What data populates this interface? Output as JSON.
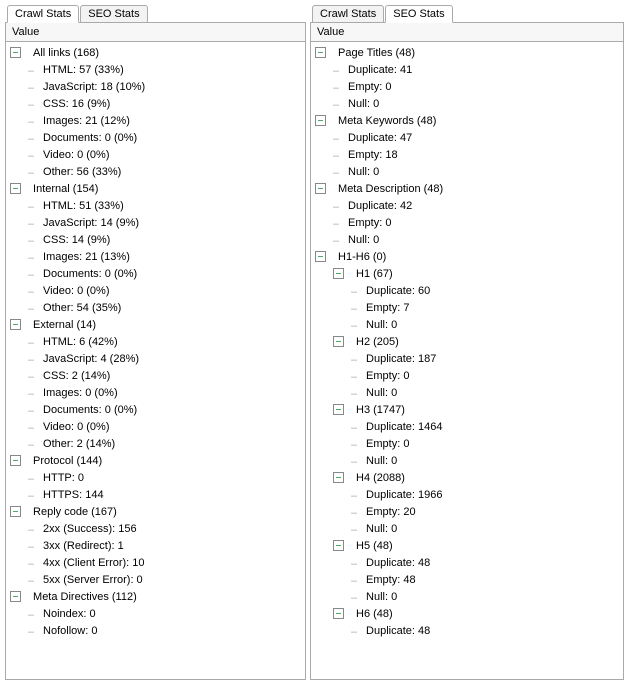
{
  "left": {
    "tabs": [
      "Crawl Stats",
      "SEO Stats"
    ],
    "active_tab_index": 0,
    "header": "Value",
    "tree": [
      {
        "depth": 0,
        "toggle": "minus",
        "label": "All links (168)"
      },
      {
        "depth": 1,
        "label": "HTML: 57 (33%)"
      },
      {
        "depth": 1,
        "label": "JavaScript: 18 (10%)"
      },
      {
        "depth": 1,
        "label": "CSS: 16 (9%)"
      },
      {
        "depth": 1,
        "label": "Images: 21 (12%)"
      },
      {
        "depth": 1,
        "label": "Documents: 0 (0%)"
      },
      {
        "depth": 1,
        "label": "Video: 0 (0%)"
      },
      {
        "depth": 1,
        "label": "Other: 56 (33%)"
      },
      {
        "depth": 0,
        "toggle": "minus",
        "label": "Internal (154)"
      },
      {
        "depth": 1,
        "label": "HTML: 51 (33%)"
      },
      {
        "depth": 1,
        "label": "JavaScript: 14 (9%)"
      },
      {
        "depth": 1,
        "label": "CSS: 14 (9%)"
      },
      {
        "depth": 1,
        "label": "Images: 21 (13%)"
      },
      {
        "depth": 1,
        "label": "Documents: 0 (0%)"
      },
      {
        "depth": 1,
        "label": "Video: 0 (0%)"
      },
      {
        "depth": 1,
        "label": "Other: 54 (35%)"
      },
      {
        "depth": 0,
        "toggle": "minus",
        "label": "External (14)"
      },
      {
        "depth": 1,
        "label": "HTML: 6 (42%)"
      },
      {
        "depth": 1,
        "label": "JavaScript: 4 (28%)"
      },
      {
        "depth": 1,
        "label": "CSS: 2 (14%)"
      },
      {
        "depth": 1,
        "label": "Images: 0 (0%)"
      },
      {
        "depth": 1,
        "label": "Documents: 0 (0%)"
      },
      {
        "depth": 1,
        "label": "Video: 0 (0%)"
      },
      {
        "depth": 1,
        "label": "Other: 2 (14%)"
      },
      {
        "depth": 0,
        "toggle": "minus",
        "label": "Protocol (144)"
      },
      {
        "depth": 1,
        "label": "HTTP: 0"
      },
      {
        "depth": 1,
        "label": "HTTPS: 144"
      },
      {
        "depth": 0,
        "toggle": "minus",
        "label": "Reply code (167)"
      },
      {
        "depth": 1,
        "label": "2xx (Success): 156"
      },
      {
        "depth": 1,
        "label": "3xx (Redirect): 1"
      },
      {
        "depth": 1,
        "label": "4xx (Client Error): 10"
      },
      {
        "depth": 1,
        "label": "5xx (Server Error): 0"
      },
      {
        "depth": 0,
        "toggle": "minus",
        "label": "Meta Directives (112)"
      },
      {
        "depth": 1,
        "label": "Noindex: 0"
      },
      {
        "depth": 1,
        "label": "Nofollow: 0"
      }
    ]
  },
  "right": {
    "tabs": [
      "Crawl Stats",
      "SEO Stats"
    ],
    "active_tab_index": 1,
    "header": "Value",
    "tree": [
      {
        "depth": 0,
        "toggle": "minus",
        "label": "Page Titles (48)"
      },
      {
        "depth": 1,
        "label": "Duplicate: 41"
      },
      {
        "depth": 1,
        "label": "Empty: 0"
      },
      {
        "depth": 1,
        "label": "Null: 0"
      },
      {
        "depth": 0,
        "toggle": "minus",
        "label": "Meta Keywords (48)"
      },
      {
        "depth": 1,
        "label": "Duplicate: 47"
      },
      {
        "depth": 1,
        "label": "Empty: 18"
      },
      {
        "depth": 1,
        "label": "Null: 0"
      },
      {
        "depth": 0,
        "toggle": "minus",
        "label": "Meta Description (48)"
      },
      {
        "depth": 1,
        "label": "Duplicate: 42"
      },
      {
        "depth": 1,
        "label": "Empty: 0"
      },
      {
        "depth": 1,
        "label": "Null: 0"
      },
      {
        "depth": 0,
        "toggle": "minus",
        "label": "H1-H6 (0)"
      },
      {
        "depth": 1,
        "toggle": "minus",
        "label": "H1 (67)"
      },
      {
        "depth": 2,
        "label": "Duplicate: 60"
      },
      {
        "depth": 2,
        "label": "Empty: 7"
      },
      {
        "depth": 2,
        "label": "Null: 0"
      },
      {
        "depth": 1,
        "toggle": "minus",
        "label": "H2 (205)"
      },
      {
        "depth": 2,
        "label": "Duplicate: 187"
      },
      {
        "depth": 2,
        "label": "Empty: 0"
      },
      {
        "depth": 2,
        "label": "Null: 0"
      },
      {
        "depth": 1,
        "toggle": "minus",
        "label": "H3 (1747)"
      },
      {
        "depth": 2,
        "label": "Duplicate: 1464"
      },
      {
        "depth": 2,
        "label": "Empty: 0"
      },
      {
        "depth": 2,
        "label": "Null: 0"
      },
      {
        "depth": 1,
        "toggle": "minus",
        "label": "H4 (2088)"
      },
      {
        "depth": 2,
        "label": "Duplicate: 1966"
      },
      {
        "depth": 2,
        "label": "Empty: 20"
      },
      {
        "depth": 2,
        "label": "Null: 0"
      },
      {
        "depth": 1,
        "toggle": "minus",
        "label": "H5 (48)"
      },
      {
        "depth": 2,
        "label": "Duplicate: 48"
      },
      {
        "depth": 2,
        "label": "Empty: 48"
      },
      {
        "depth": 2,
        "label": "Null: 0"
      },
      {
        "depth": 1,
        "toggle": "minus",
        "label": "H6 (48)"
      },
      {
        "depth": 2,
        "label": "Duplicate: 48"
      }
    ]
  }
}
